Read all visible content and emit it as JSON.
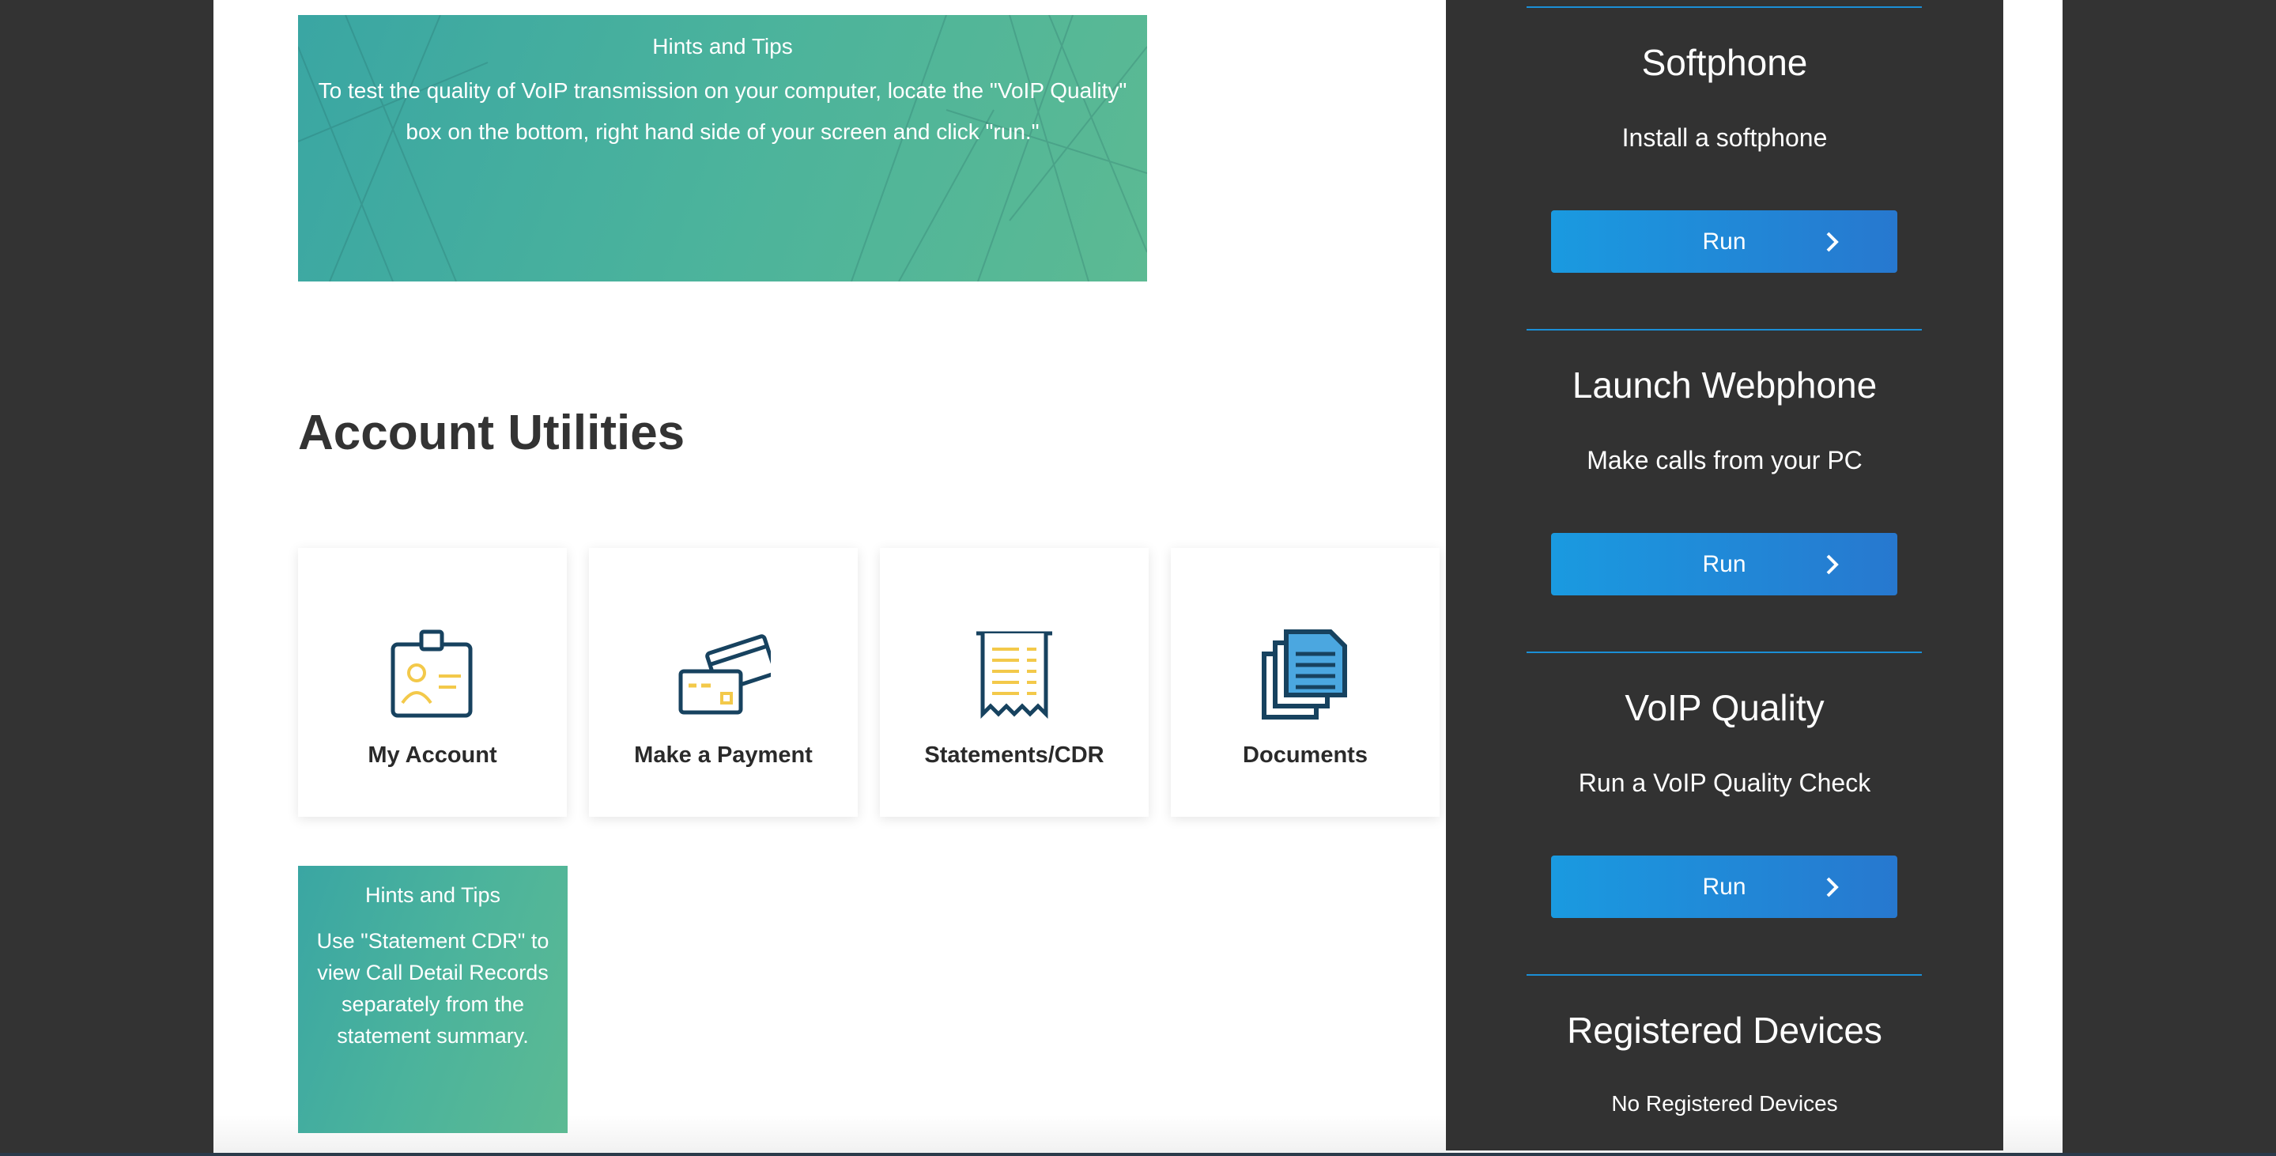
{
  "hint_top": {
    "title": "Hints and Tips",
    "text": "To test the quality of VoIP transmission on your computer, locate the \"VoIP Quality\" box on the bottom, right hand side of your screen and click \"run.\""
  },
  "account_utilities": {
    "title": "Account Utilities",
    "tiles": [
      {
        "label": "My Account",
        "icon": "id-badge-icon"
      },
      {
        "label": "Make a Payment",
        "icon": "payment-cards-icon"
      },
      {
        "label": "Statements/CDR",
        "icon": "receipt-icon"
      },
      {
        "label": "Documents",
        "icon": "documents-icon"
      }
    ]
  },
  "hint_small": {
    "title": "Hints and Tips",
    "text": "Use \"Statement CDR\" to view Call Detail Records separately from the statement summary."
  },
  "sidebar": {
    "softphone": {
      "title": "Softphone",
      "subtitle": "Install a softphone",
      "button": "Run"
    },
    "webphone": {
      "title": "Launch Webphone",
      "subtitle": "Make calls from your PC",
      "button": "Run"
    },
    "voip_quality": {
      "title": "VoIP Quality",
      "subtitle": "Run a VoIP Quality Check",
      "button": "Run"
    },
    "registered_devices": {
      "title": "Registered Devices",
      "text": "No Registered Devices"
    }
  },
  "colors": {
    "frame": "#333333",
    "panel": "#323232",
    "accent_blue": "#1b8fd6",
    "hint_green": "#4bb39c",
    "icon_navy": "#17425f",
    "icon_yellow": "#f3c94a"
  }
}
